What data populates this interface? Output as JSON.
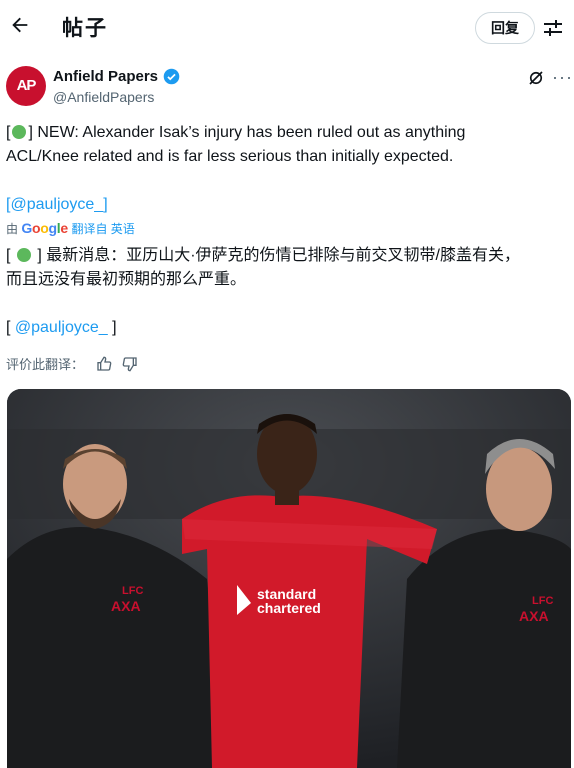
{
  "header": {
    "title": "帖子",
    "reply_label": "回复"
  },
  "author": {
    "name": "Anfield Papers",
    "handle": "@AnfieldPapers",
    "avatar_text": "AP"
  },
  "tweet": {
    "line1_pre": "[",
    "line1_post": "] NEW: Alexander Isak’s injury has been ruled out as anything",
    "line2": "ACL/Knee related and is far less serious than initially expected.",
    "mention": "[@pauljoyce_]"
  },
  "translation": {
    "by": "由",
    "google": "Google",
    "action": "翻译自 英语",
    "line1_pre": "[ ",
    "line1_post": " ] 最新消息：亚历山大·伊萨克的伤情已排除与前交叉韧带/膝盖有关，",
    "line2": "而且远没有最初预期的那么严重。",
    "mention_pre": "[ ",
    "mention": "@pauljoyce_",
    "mention_post": " ]",
    "rate_label": "评价此翻译："
  },
  "photo": {
    "shirt_sponsor_1": "standard",
    "shirt_sponsor_2": "chartered",
    "crest": "LFC",
    "jacket_sponsor": "AXA"
  },
  "colors": {
    "accent": "#1d9bf0",
    "brand_red": "#c8102e",
    "dot": "#5cb85c"
  }
}
